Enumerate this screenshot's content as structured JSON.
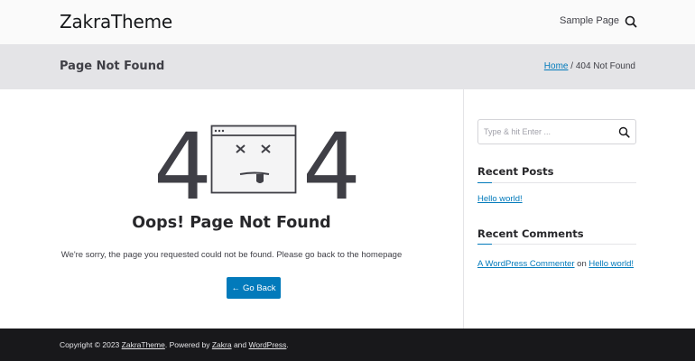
{
  "header": {
    "site_title": "ZakraTheme",
    "nav": [
      {
        "label": "Sample Page"
      }
    ],
    "search_icon": "search-icon"
  },
  "title_band": {
    "title": "Page Not Found",
    "breadcrumb": {
      "home": "Home",
      "separator": "/",
      "current": "404 Not Found"
    }
  },
  "error": {
    "digit_left": "4",
    "digit_right": "4",
    "illustration": "dead-browser-illustration",
    "heading": "Oops! Page Not Found",
    "message": "We're sorry, the page you requested could not be found. Please go back to the homepage",
    "button_arrow": "←",
    "button_label": "Go Back"
  },
  "sidebar": {
    "search": {
      "placeholder": "Type & hit Enter ...",
      "value": "",
      "icon": "search-icon"
    },
    "recent_posts": {
      "title": "Recent Posts",
      "items": [
        "Hello world!"
      ]
    },
    "recent_comments": {
      "title": "Recent Comments",
      "items": [
        {
          "author": "A WordPress Commenter",
          "on": "on",
          "post": "Hello world!"
        }
      ]
    }
  },
  "footer": {
    "copyright": "Copyright © 2023",
    "site_link": "ZakraTheme",
    "powered_by": ". Powered by",
    "theme_link": "Zakra",
    "and": "and",
    "wp_link": "WordPress",
    "end": "."
  },
  "colors": {
    "accent": "#027abb",
    "header_bg": "#fafafa",
    "title_band_bg": "#e4e4e7",
    "footer_bg": "#18181b",
    "text": "#3f3f46"
  }
}
